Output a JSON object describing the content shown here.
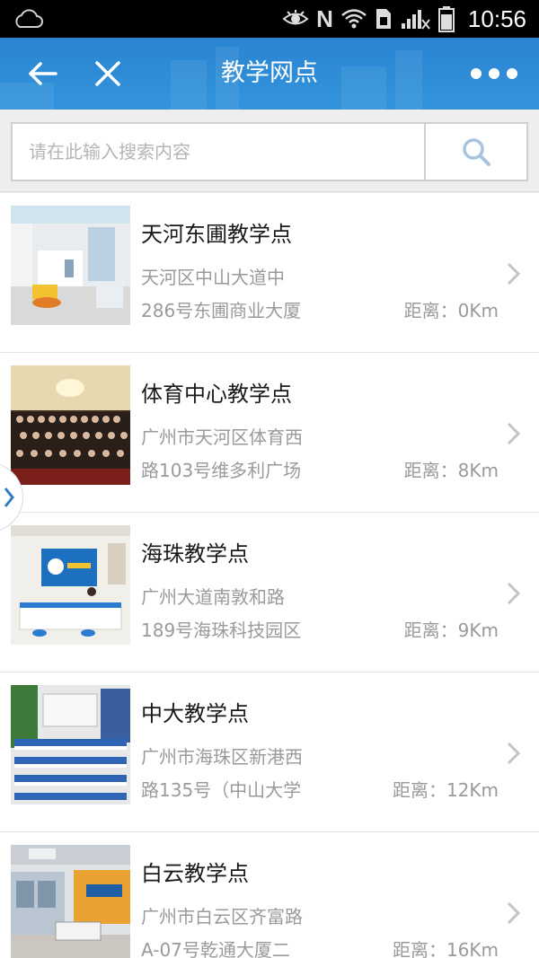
{
  "status_bar": {
    "time": "10:56",
    "icons": [
      "cloud-icon",
      "eye-icon",
      "nfc-icon",
      "wifi-icon",
      "sim-icon",
      "signal-icon",
      "battery-icon"
    ],
    "nfc_letter": "N"
  },
  "header": {
    "title": "教学网点",
    "back_icon": "back-arrow-icon",
    "close_icon": "close-icon",
    "more_icon": "more-dots-icon",
    "color": "#2e8dd8"
  },
  "search": {
    "placeholder": "请在此输入搜索内容",
    "value": "",
    "button_icon": "search-icon"
  },
  "locations": [
    {
      "name": "天河东圃教学点",
      "address_line1": "天河区中山大道中",
      "address_line2": "286号东圃商业大厦",
      "distance": "距离：0Km"
    },
    {
      "name": "体育中心教学点",
      "address_line1": "广州市天河区体育西",
      "address_line2": "路103号维多利广场",
      "distance": "距离：8Km"
    },
    {
      "name": "海珠教学点",
      "address_line1": "广州大道南敦和路",
      "address_line2": "189号海珠科技园区",
      "distance": "距离：9Km"
    },
    {
      "name": "中大教学点",
      "address_line1": "广州市海珠区新港西",
      "address_line2": "路135号（中山大学",
      "distance": "距离：12Km"
    },
    {
      "name": "白云教学点",
      "address_line1": "广州市白云区齐富路",
      "address_line2": "A-07号乾通大厦二",
      "distance": "距离：16Km"
    }
  ],
  "side_handle_icon": "chevron-right-icon"
}
